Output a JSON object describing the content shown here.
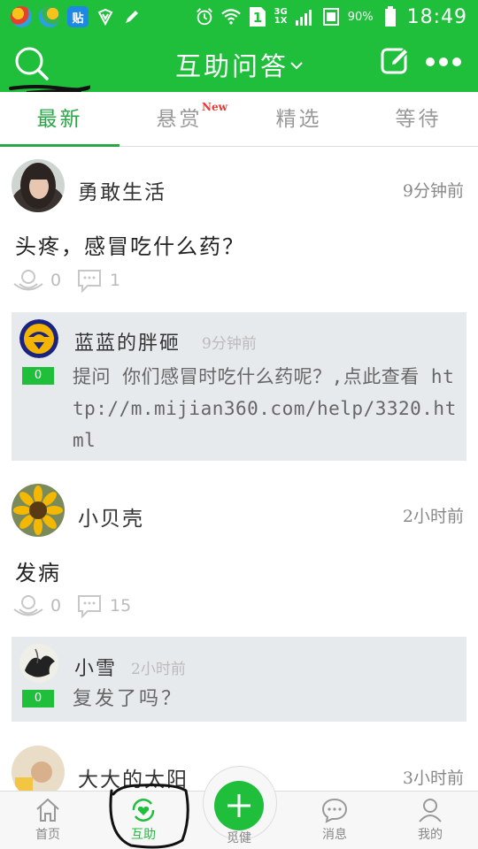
{
  "status_bar": {
    "app_badge": "贴",
    "sim": "1",
    "network_top": "3G",
    "network_bottom": "1X",
    "battery_pct": "90%",
    "time": "18:49"
  },
  "header": {
    "title": "互助问答"
  },
  "tabs": [
    {
      "label": "最新",
      "active": true
    },
    {
      "label": "悬赏",
      "badge": "New"
    },
    {
      "label": "精选"
    },
    {
      "label": "等待"
    }
  ],
  "feed": [
    {
      "author": "勇敢生活",
      "time": "9分钟前",
      "question": "头疼，感冒吃什么药？",
      "likes": "0",
      "comments": "1",
      "answer": {
        "author": "蓝蓝的胖砸",
        "time": "9分钟前",
        "votes": "0",
        "text": "提问 你们感冒时吃什么药呢？,点此查看 http://m.mijian360.com/help/3320.html"
      }
    },
    {
      "author": "小贝壳",
      "time": "2小时前",
      "question": "发病",
      "likes": "0",
      "comments": "15",
      "answer": {
        "author": "小雪",
        "time": "2小时前",
        "votes": "0",
        "text": "复发了吗？"
      }
    },
    {
      "author": "大大的太阳",
      "time": "3小时前"
    }
  ],
  "bottom_nav": {
    "home": "首页",
    "mutual": "互助",
    "plus": "觅健",
    "messages": "消息",
    "mine": "我的"
  },
  "colors": {
    "brand_green": "#1fbf3c",
    "tab_active": "#29a745",
    "badge_red": "#e53935"
  }
}
